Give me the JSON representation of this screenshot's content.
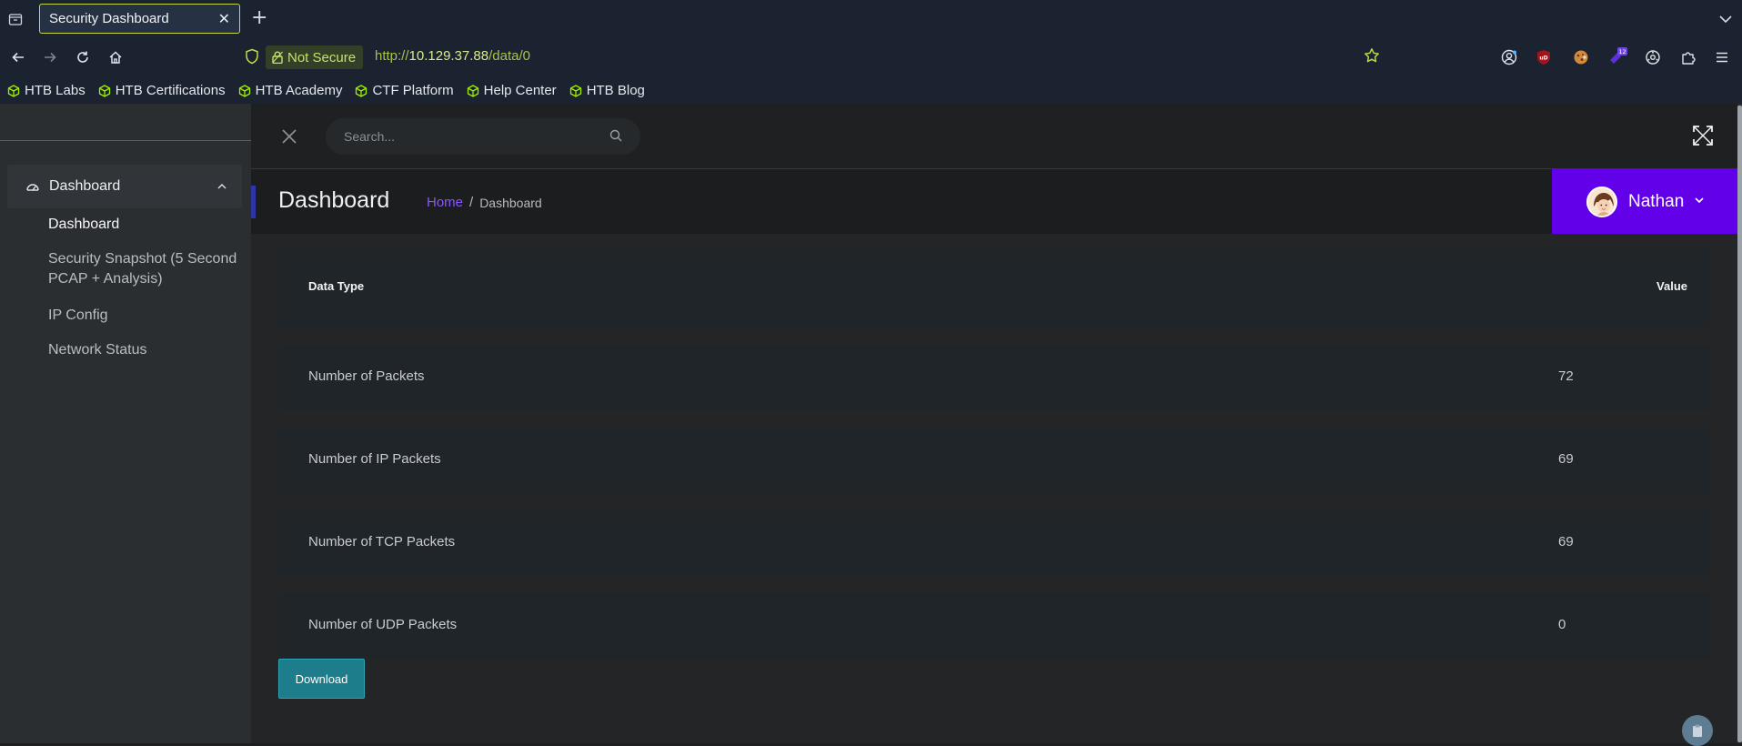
{
  "browser": {
    "tab_title": "Security Dashboard",
    "tab_close": "✕",
    "new_tab": "+",
    "not_secure_label": "Not Secure",
    "url_prefix": "http://",
    "url_host": "10.129.37.88",
    "url_path": "/data/0",
    "extension_badge": "12",
    "bookmarks": [
      {
        "label": "HTB Labs"
      },
      {
        "label": "HTB Certifications"
      },
      {
        "label": "HTB Academy"
      },
      {
        "label": "CTF Platform"
      },
      {
        "label": "Help Center"
      },
      {
        "label": "HTB Blog"
      }
    ],
    "accent_color": "#c6d84a"
  },
  "sidebar": {
    "group_label": "Dashboard",
    "items": [
      {
        "label": "Dashboard",
        "active": true
      },
      {
        "label": "Security Snapshot (5 Second PCAP + Analysis)",
        "active": false
      },
      {
        "label": "IP Config",
        "active": false
      },
      {
        "label": "Network Status",
        "active": false
      }
    ]
  },
  "topbar": {
    "search_placeholder": "Search..."
  },
  "header": {
    "title": "Dashboard",
    "breadcrumb": {
      "home": "Home",
      "separator": "/",
      "current": "Dashboard"
    },
    "user_name": "Nathan",
    "user_bg_color": "#6200ea",
    "breadcrumb_link_color": "#8a54ff"
  },
  "table": {
    "columns": [
      "Data Type",
      "Value"
    ],
    "rows": [
      {
        "label": "Number of Packets",
        "value": "72"
      },
      {
        "label": "Number of IP Packets",
        "value": "69"
      },
      {
        "label": "Number of TCP Packets",
        "value": "69"
      },
      {
        "label": "Number of UDP Packets",
        "value": "0"
      }
    ]
  },
  "actions": {
    "download_label": "Download",
    "download_color": "#1e7d8a"
  }
}
